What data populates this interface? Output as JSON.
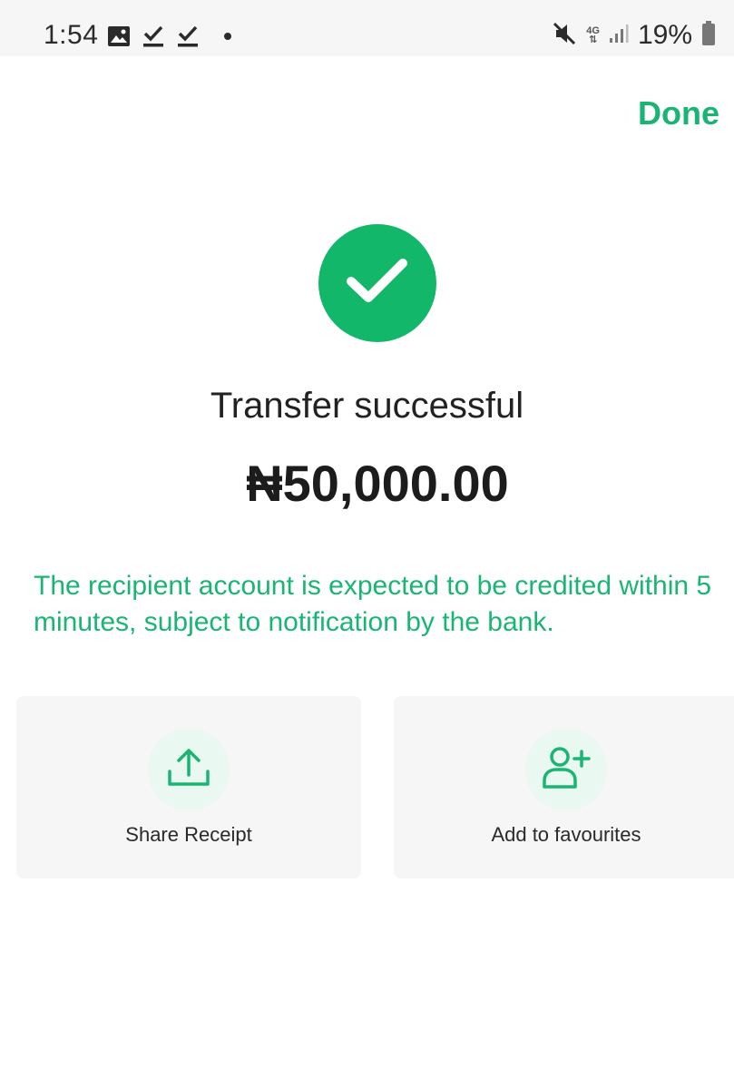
{
  "status_bar": {
    "time": "1:54",
    "network": "4G",
    "battery": "19%",
    "icons": [
      "image-icon",
      "download-done-icon",
      "download-done-icon",
      "dot-icon",
      "mute-icon",
      "network-4g-icon",
      "signal-icon",
      "battery-icon"
    ]
  },
  "header": {
    "done_label": "Done"
  },
  "result": {
    "icon": "check-icon",
    "title": "Transfer successful",
    "amount": "₦50,000.00",
    "notice": "The recipient account is expected to be credited within 5 minutes, subject to notification by the bank."
  },
  "actions": [
    {
      "label": "Share Receipt",
      "icon": "share-upload-icon"
    },
    {
      "label": "Add to favourites",
      "icon": "add-user-icon"
    }
  ],
  "colors": {
    "accent": "#1ab574",
    "success": "#12b76a",
    "card_bg": "#f6f6f7",
    "icon_bg": "#e9f8f0"
  }
}
